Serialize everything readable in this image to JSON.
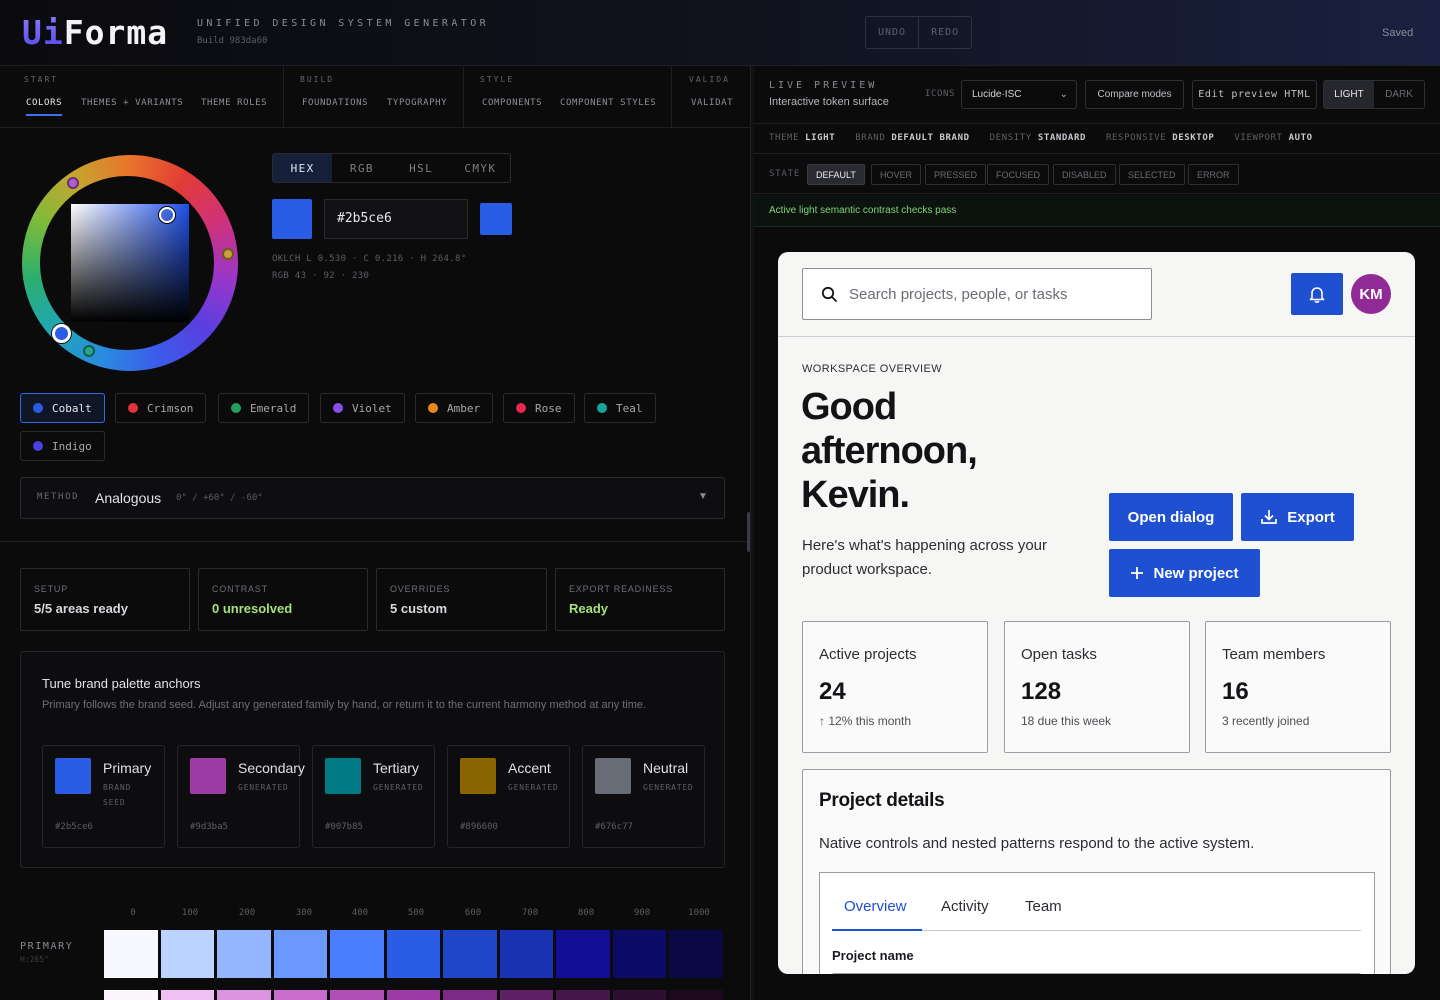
{
  "brand": {
    "logo_ui": "Ui",
    "logo_forma": "Forma",
    "subtitle": "UNIFIED DESIGN SYSTEM GENERATOR",
    "build": "Build 983da60"
  },
  "toolbar": {
    "undo": "UNDO",
    "redo": "REDO",
    "status": "Saved"
  },
  "nav": {
    "groups": [
      {
        "label": "START",
        "items": [
          "COLORS",
          "THEMES + VARIANTS",
          "THEME ROLES"
        ]
      },
      {
        "label": "BUILD",
        "items": [
          "FOUNDATIONS",
          "TYPOGRAPHY"
        ]
      },
      {
        "label": "STYLE",
        "items": [
          "COMPONENTS",
          "COMPONENT STYLES"
        ]
      },
      {
        "label": "VALIDA",
        "items": [
          "VALIDAT"
        ]
      }
    ],
    "active": "COLORS"
  },
  "picker": {
    "formats": [
      "HEX",
      "RGB",
      "HSL",
      "CMYK"
    ],
    "active_format": "HEX",
    "hex_value": "#2b5ce6",
    "current_color": "#2b5ce6",
    "oklch": "OKLCH L 0.530 · C 0.216 · H 264.8°",
    "rgb": "RGB 43 · 92 · 230"
  },
  "presets": [
    {
      "name": "Cobalt",
      "color": "#2b5ce6",
      "active": true
    },
    {
      "name": "Crimson",
      "color": "#e0323f"
    },
    {
      "name": "Emerald",
      "color": "#22a05a"
    },
    {
      "name": "Violet",
      "color": "#8a4fe8"
    },
    {
      "name": "Amber",
      "color": "#e88a1a"
    },
    {
      "name": "Rose",
      "color": "#e5294f"
    },
    {
      "name": "Teal",
      "color": "#14a79b"
    },
    {
      "name": "Indigo",
      "color": "#4a3fe0"
    }
  ],
  "method": {
    "label": "METHOD",
    "value": "Analogous",
    "degrees": "0° / +60° / -60°",
    "caret": "▼"
  },
  "stats": [
    {
      "label": "SETUP",
      "value": "5/5 areas ready"
    },
    {
      "label": "CONTRAST",
      "value": "0 unresolved"
    },
    {
      "label": "OVERRIDES",
      "value": "5 custom"
    },
    {
      "label": "EXPORT READINESS",
      "value": "Ready"
    }
  ],
  "tune": {
    "title": "Tune brand palette anchors",
    "desc": "Primary follows the brand seed. Adjust any generated family by hand, or return it to the current harmony method at any time.",
    "anchors": [
      {
        "name": "Primary",
        "role": "BRAND",
        "role2": "SEED",
        "hex": "#2b5ce6",
        "color": "#2b5ce6"
      },
      {
        "name": "Secondary",
        "role": "GENERATED",
        "role2": "",
        "hex": "#9d3ba5",
        "color": "#9d3ba5"
      },
      {
        "name": "Tertiary",
        "role": "GENERATED",
        "role2": "",
        "hex": "#007b85",
        "color": "#007b85"
      },
      {
        "name": "Accent",
        "role": "GENERATED",
        "role2": "",
        "hex": "#896600",
        "color": "#896600"
      },
      {
        "name": "Neutral",
        "role": "GENERATED",
        "role2": "",
        "hex": "#676c77",
        "color": "#676c77"
      }
    ]
  },
  "scale": {
    "steps": [
      "0",
      "100",
      "200",
      "300",
      "400",
      "500",
      "600",
      "700",
      "800",
      "900",
      "1000"
    ],
    "label": "PRIMARY",
    "sub": "H:265°",
    "colors": [
      "#f7f9ff",
      "#bcd3ff",
      "#93b6ff",
      "#6b98ff",
      "#4a7eff",
      "#2b5ce6",
      "#1f45c9",
      "#1832b3",
      "#120f95",
      "#0b0a66",
      "#0a0945"
    ],
    "secondary_colors": [
      "#fbf7fc",
      "#f0c0f3",
      "#dc94e0",
      "#c86dcc",
      "#b14fb6",
      "#9d3ba5",
      "#7c2a84",
      "#5e1f65",
      "#451649",
      "#2e0f31",
      "#1c091d"
    ]
  },
  "preview": {
    "label": "LIVE PREVIEW",
    "sub": "Interactive token surface",
    "icons_label": "ICONS",
    "icons_value": "Lucide·ISC",
    "compare": "Compare modes",
    "edit_html": "Edit preview HTML",
    "modes": [
      "LIGHT",
      "DARK"
    ],
    "active_mode": "LIGHT",
    "tokens": [
      {
        "key": "THEME",
        "val": "LIGHT"
      },
      {
        "key": "BRAND",
        "val": "DEFAULT BRAND"
      },
      {
        "key": "DENSITY",
        "val": "STANDARD"
      },
      {
        "key": "RESPONSIVE",
        "val": "DESKTOP"
      },
      {
        "key": "VIEWPORT",
        "val": "AUTO"
      }
    ],
    "state_label": "STATE",
    "states": [
      "DEFAULT",
      "HOVER",
      "PRESSED",
      "FOCUSED",
      "DISABLED",
      "SELECTED",
      "ERROR"
    ],
    "active_state": "DEFAULT",
    "contrast_msg": "Active light semantic contrast checks pass"
  },
  "app": {
    "search_placeholder": "Search projects, people, or tasks",
    "avatar": "KM",
    "eyebrow": "WORKSPACE OVERVIEW",
    "greeting": "Good afternoon, Kevin.",
    "desc": "Here's what's happening across your product workspace.",
    "buttons": {
      "open_dialog": "Open dialog",
      "export": "Export",
      "new_project": "New project"
    },
    "metrics": [
      {
        "label": "Active projects",
        "value": "24",
        "sub": "12% this month"
      },
      {
        "label": "Open tasks",
        "value": "128",
        "sub": "18 due this week"
      },
      {
        "label": "Team members",
        "value": "16",
        "sub": "3 recently joined"
      }
    ],
    "details": {
      "title": "Project details",
      "desc": "Native controls and nested patterns respond to the active system.",
      "tabs": [
        "Overview",
        "Activity",
        "Team"
      ],
      "active_tab": "Overview",
      "field_label": "Project name"
    },
    "accent": "#1f50d2"
  }
}
